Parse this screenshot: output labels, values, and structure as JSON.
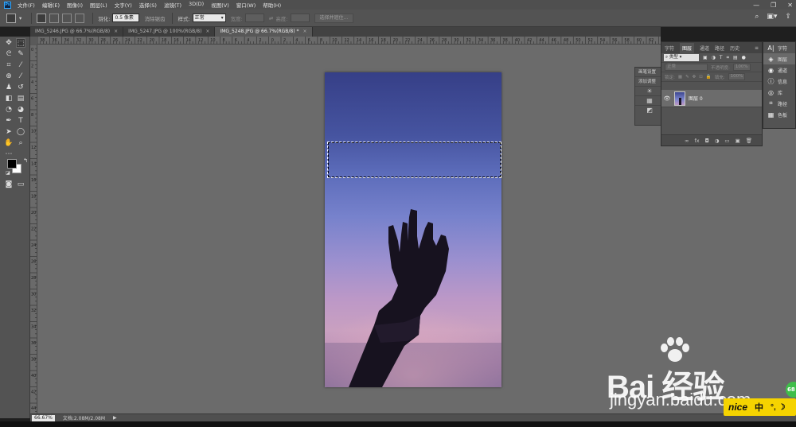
{
  "app": {
    "logo": "Ps"
  },
  "menu": [
    "文件(F)",
    "编辑(E)",
    "图像(I)",
    "图层(L)",
    "文字(Y)",
    "选择(S)",
    "滤镜(T)",
    "3D(D)",
    "视图(V)",
    "窗口(W)",
    "帮助(H)"
  ],
  "window_controls": {
    "minimize": "—",
    "restore": "❐",
    "close": "✕"
  },
  "options": {
    "feather_label": "羽化:",
    "feather_value": "0.5 像素",
    "antialias_label": "消除锯齿",
    "style_label": "样式:",
    "style_value": "正常",
    "width_label": "宽度:",
    "height_label": "高度:",
    "refine_button": "选择并遮住..."
  },
  "tabs": [
    {
      "label": "IMG_5246.JPG @ 66.7%(RGB/8)",
      "close": "×",
      "active": false
    },
    {
      "label": "IMG_5247.JPG @ 100%(RGB/8)",
      "close": "×",
      "active": false
    },
    {
      "label": "IMG_5248.JPG @ 66.7%(RGB/8) *",
      "close": "×",
      "active": true
    }
  ],
  "ruler_top_labels": [
    "38",
    "36",
    "34",
    "32",
    "30",
    "28",
    "26",
    "24",
    "22",
    "20",
    "18",
    "16",
    "14",
    "12",
    "10",
    "8",
    "6",
    "4",
    "2",
    "0",
    "2",
    "4",
    "6",
    "8",
    "10",
    "12",
    "14",
    "16",
    "18",
    "20",
    "22",
    "24",
    "26",
    "28",
    "30",
    "32",
    "34",
    "36",
    "38",
    "40",
    "42",
    "44",
    "46",
    "48",
    "50",
    "52",
    "54",
    "56",
    "58",
    "60",
    "62"
  ],
  "ruler_left_labels": [
    "0",
    "2",
    "4",
    "6",
    "8",
    "10",
    "12",
    "14",
    "16",
    "18",
    "20",
    "22",
    "24",
    "26",
    "28",
    "30",
    "32",
    "34",
    "36",
    "38",
    "40",
    "42",
    "44"
  ],
  "status": {
    "zoom": "66.67%",
    "doc": "文档:2.08M/2.08M",
    "arrow": "▶"
  },
  "brush_panel": [
    "画笔设置",
    "添加调整",
    "☀",
    "▦",
    "◩"
  ],
  "layers_panel": {
    "tabs": [
      "字符",
      "图层",
      "通道",
      "路径",
      "历史"
    ],
    "filter_label": "类型",
    "blend_mode": "正常",
    "opacity_label": "不透明度:",
    "opacity_value": "100%",
    "lock_label": "锁定:",
    "fill_label": "填充:",
    "fill_value": "100%",
    "layer_name": "图层 0",
    "bottom_icons": [
      "∞",
      "fx",
      "◘",
      "◑",
      "▭",
      "▣",
      "🗑"
    ]
  },
  "right_dock": [
    {
      "label": "字符",
      "icon": "A|"
    },
    {
      "label": "图层",
      "icon": "◈"
    },
    {
      "label": "通道",
      "icon": "◉"
    },
    {
      "label": "信息",
      "icon": "ⓘ"
    },
    {
      "label": "库",
      "icon": "◎"
    },
    {
      "label": "路径",
      "icon": "⌗"
    },
    {
      "label": "色板",
      "icon": "▦"
    }
  ],
  "watermark": {
    "text": "Bai 经验",
    "url": "jingyan.baidu.com"
  },
  "ime": {
    "brand": "nice",
    "lang": "中",
    "extra": "°, ☽"
  },
  "badge": {
    "text": "68"
  }
}
